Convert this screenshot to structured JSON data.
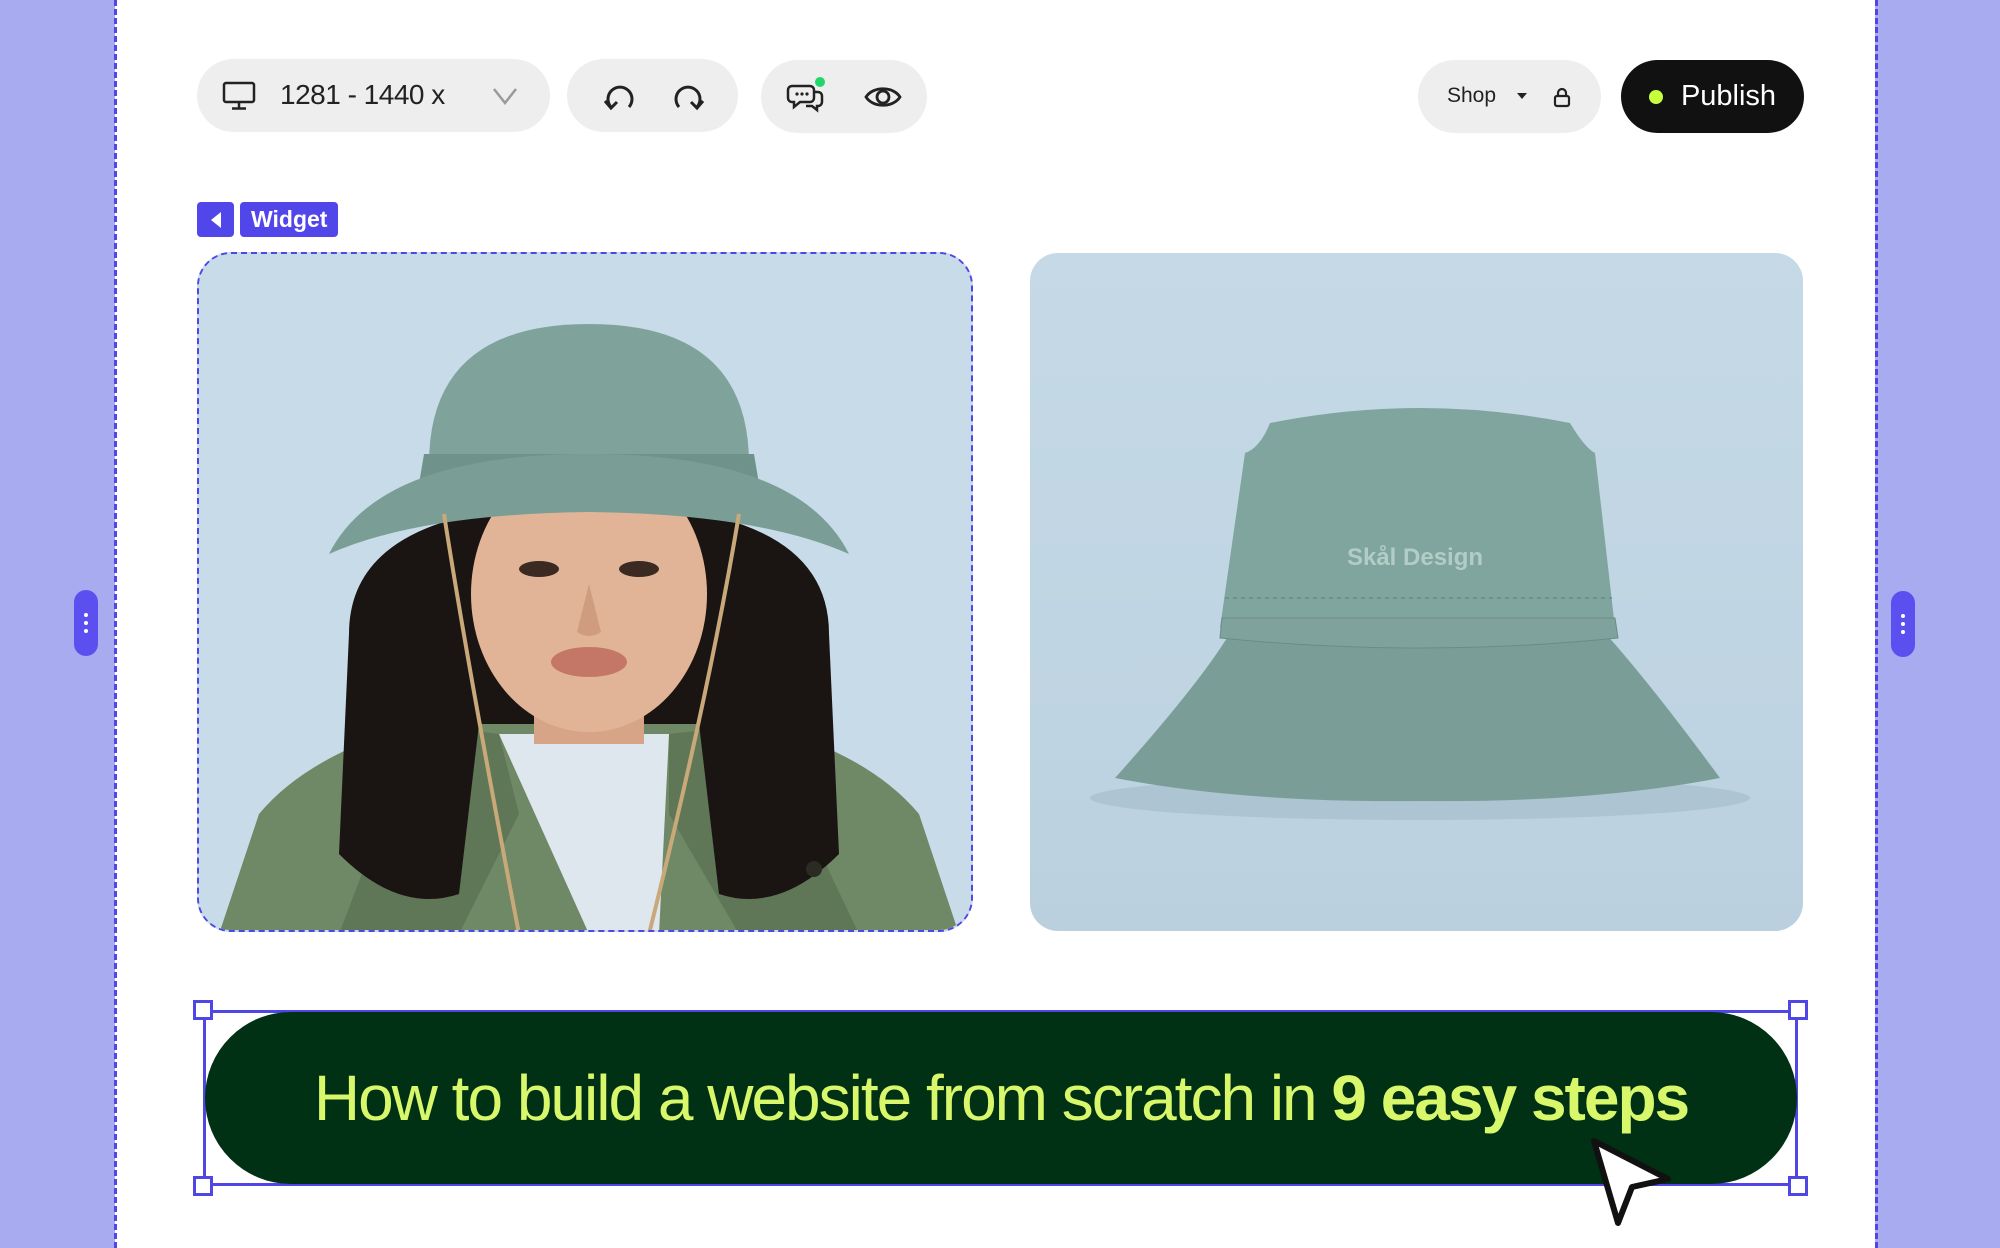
{
  "toolbar": {
    "device_range": "1281 - 1440 x",
    "shop_label": "Shop",
    "publish_label": "Publish"
  },
  "widget": {
    "tag_label": "Widget"
  },
  "product": {
    "hat_brand": "Skål Design"
  },
  "banner": {
    "text_regular": "How to build a website from scratch in ",
    "text_bold": "9 easy steps"
  },
  "colors": {
    "accent": "#5146ea",
    "side_panel": "#a8abf0",
    "publish_bg": "#111111",
    "publish_dot": "#c6ff3d",
    "banner_bg": "#003114",
    "banner_text": "#d9f76a",
    "photo_bg": "#c7dbe8",
    "hat_green": "#7fa39a"
  },
  "icons": [
    "desktop-icon",
    "chevron-down-icon",
    "undo-icon",
    "redo-icon",
    "comments-icon",
    "eye-icon",
    "caret-down-icon",
    "lock-icon",
    "arrow-left-icon",
    "cursor-arrow-icon"
  ]
}
